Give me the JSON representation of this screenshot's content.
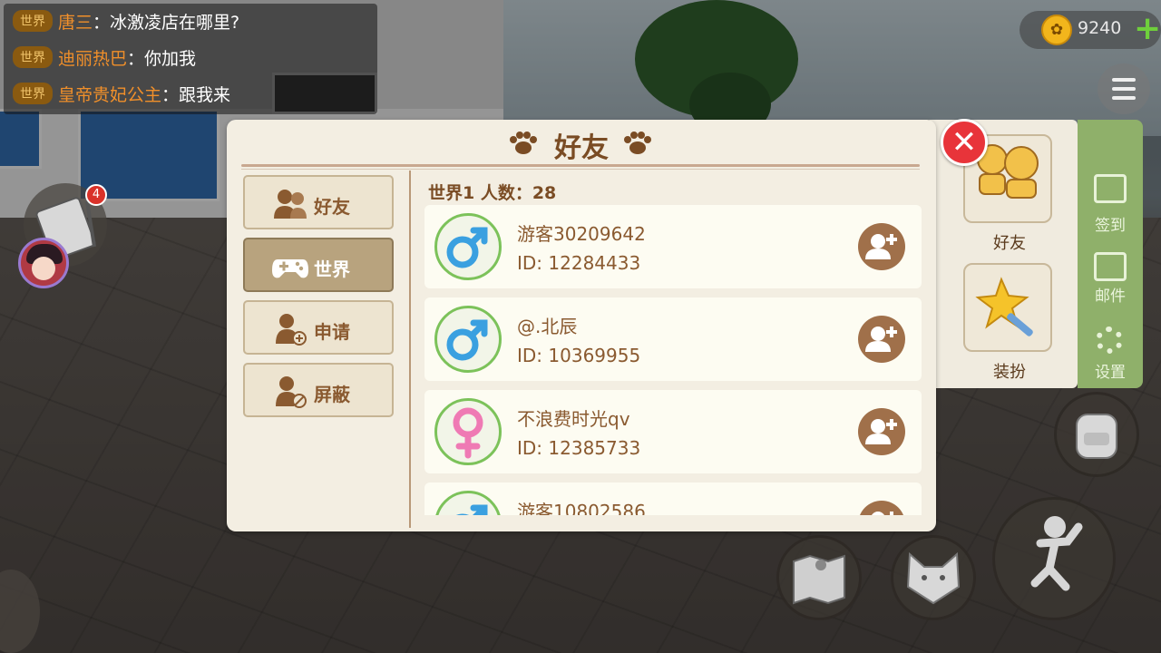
{
  "chat": [
    {
      "tag": "世界",
      "name": "唐三",
      "message": "冰激凌店在哪里?"
    },
    {
      "tag": "世界",
      "name": "迪丽热巴",
      "message": "你加我"
    },
    {
      "tag": "世界",
      "name": "皇帝贵妃公主",
      "message": "跟我来"
    }
  ],
  "hud": {
    "coins": "9240",
    "notification_count": "4"
  },
  "side_panel": {
    "tiles": [
      {
        "label": "好友",
        "icon": "friends-icon"
      },
      {
        "label": "装扮",
        "icon": "magic-wand-icon"
      }
    ],
    "menu": [
      {
        "label": "签到",
        "icon": "checkin-icon"
      },
      {
        "label": "邮件",
        "icon": "mail-icon"
      },
      {
        "label": "设置",
        "icon": "gear-icon"
      }
    ]
  },
  "dialog": {
    "title": "好友",
    "tabs": [
      {
        "label": "好友",
        "icon": "friends-icon",
        "active": false
      },
      {
        "label": "世界",
        "icon": "gamepad-icon",
        "active": true
      },
      {
        "label": "申请",
        "icon": "request-icon",
        "active": false
      },
      {
        "label": "屏蔽",
        "icon": "block-icon",
        "active": false
      }
    ],
    "list_header": "世界1  人数：28",
    "players": [
      {
        "name": "游客30209642",
        "id": "ID: 12284433",
        "gender": "male"
      },
      {
        "name": "@.北辰",
        "id": "ID: 10369955",
        "gender": "male"
      },
      {
        "name": "不浪费时光qv",
        "id": "ID: 12385733",
        "gender": "female"
      },
      {
        "name": "游客10802586",
        "id": "",
        "gender": "male"
      }
    ]
  },
  "colors": {
    "accent_brown": "#8a5a30",
    "active_tab": "#b8a37e",
    "close_red": "#e8343a",
    "male_blue": "#3aa0e0",
    "female_pink": "#ef7ab4"
  }
}
